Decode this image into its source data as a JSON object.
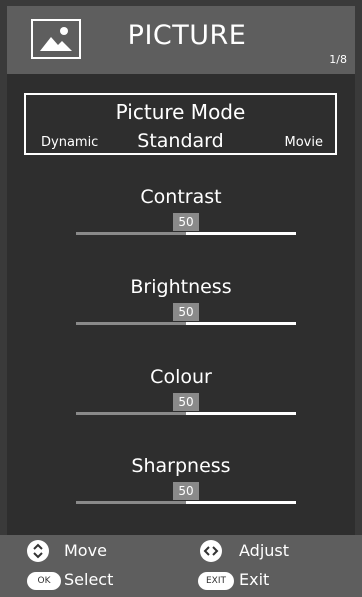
{
  "header": {
    "title": "PICTURE",
    "page_indicator": "1/8",
    "icon": "picture-icon"
  },
  "picture_mode": {
    "label": "Picture Mode",
    "previous_option": "Dynamic",
    "current_value": "Standard",
    "next_option": "Movie"
  },
  "settings": [
    {
      "label": "Contrast",
      "value": "50",
      "level": 0.5
    },
    {
      "label": "Brightness",
      "value": "50",
      "level": 0.5
    },
    {
      "label": "Colour",
      "value": "50",
      "level": 0.5
    },
    {
      "label": "Sharpness",
      "value": "50",
      "level": 0.5
    }
  ],
  "footer": {
    "move_label": "Move",
    "adjust_label": "Adjust",
    "select_label": "Select",
    "exit_label": "Exit",
    "ok_key": "OK",
    "exit_key": "EXIT"
  },
  "colors": {
    "header_bg": "#5e5e5e",
    "panel_bg": "#2e2e2e",
    "slider_fill": "#8a8a8a",
    "highlight": "#ffffff"
  }
}
